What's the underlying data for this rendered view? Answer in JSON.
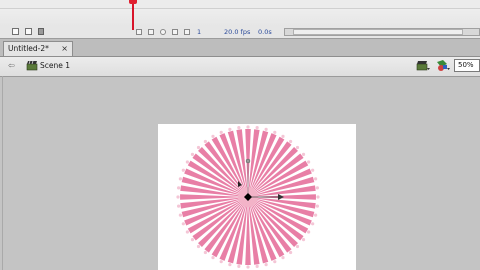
{
  "timeline": {
    "fps": "20.0 fps",
    "time": "0.0s",
    "frame": "1",
    "playhead_color": "#d8152a"
  },
  "document_tab": {
    "title": "Untitled-2*",
    "close_glyph": "×"
  },
  "edit_bar": {
    "back_glyph": "⇦",
    "scene_name": "Scene 1",
    "zoom": "50%"
  },
  "stage": {
    "background": "#ffffff",
    "artwork": "radial-burst",
    "artwork_color": "#e87fa6",
    "ray_count": 48
  },
  "icons": {
    "scene": "clapperboard-icon",
    "edit_scene": "edit-scene-icon",
    "edit_symbol": "edit-symbol-icon",
    "new_layer": "new-layer-icon",
    "new_folder": "new-folder-icon",
    "delete": "trash-icon",
    "transform_point": "transform-point-icon"
  }
}
